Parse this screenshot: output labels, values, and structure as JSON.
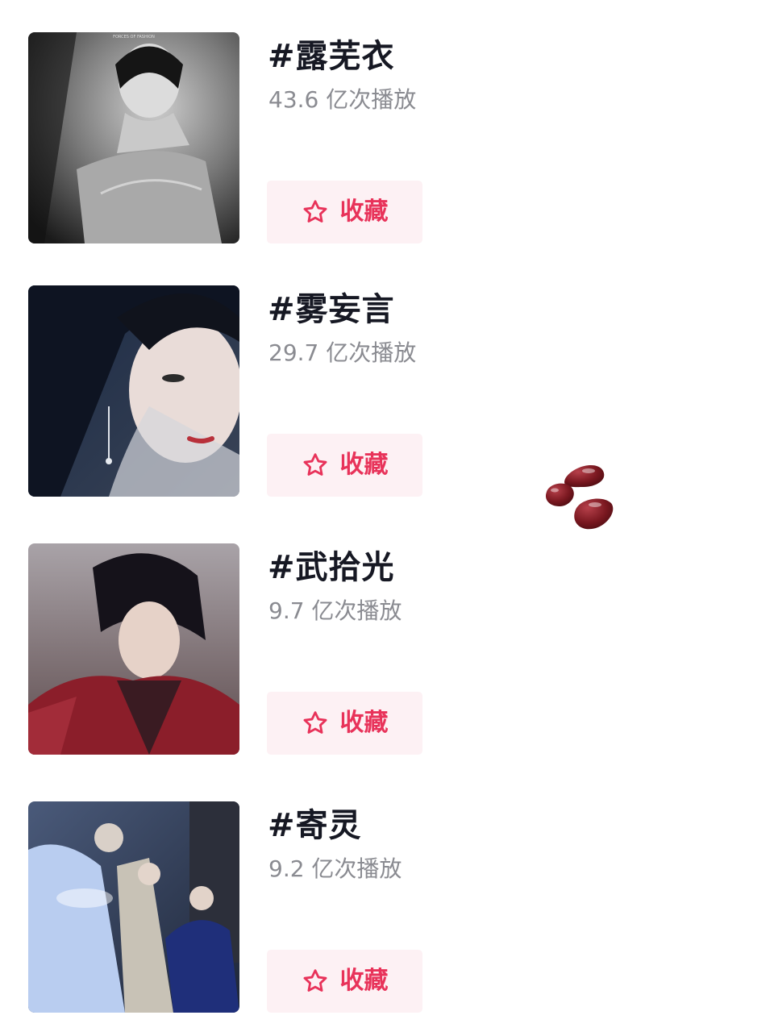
{
  "items": [
    {
      "title": "#露芜衣",
      "plays": "43.6 亿次播放",
      "fav_label": "收藏",
      "thumb_text": "FORCES OF FASHION"
    },
    {
      "title": "#雾妄言",
      "plays": "29.7 亿次播放",
      "fav_label": "收藏"
    },
    {
      "title": "#武拾光",
      "plays": "9.7 亿次播放",
      "fav_label": "收藏"
    },
    {
      "title": "#寄灵",
      "plays": "9.2 亿次播放",
      "fav_label": "收藏"
    }
  ],
  "emoji": {
    "icon": "red-beans-emoji"
  },
  "colors": {
    "accent": "#e8335a",
    "button_bg": "#fdf1f4",
    "title": "#161823",
    "meta": "#8a8b91"
  }
}
